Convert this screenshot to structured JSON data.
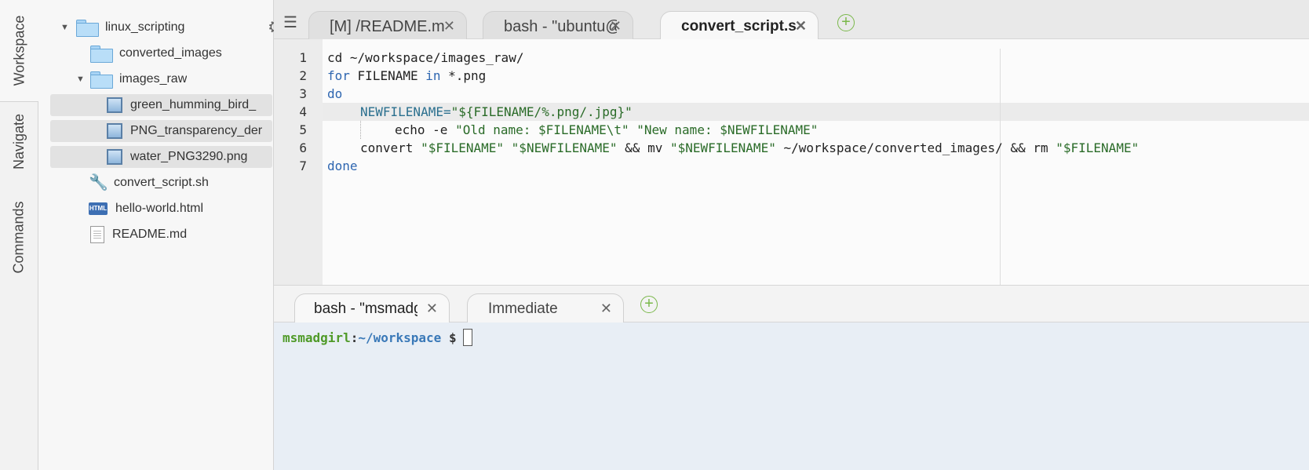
{
  "sidebar_tabs": [
    "Workspace",
    "Navigate",
    "Commands"
  ],
  "tree": {
    "root": "linux_scripting",
    "items": [
      {
        "label": "converted_images"
      },
      {
        "label": "images_raw"
      },
      {
        "label": "green_humming_bird_"
      },
      {
        "label": "PNG_transparency_der"
      },
      {
        "label": "water_PNG3290.png"
      },
      {
        "label": "convert_script.sh"
      },
      {
        "label": "hello-world.html"
      },
      {
        "label": "README.md"
      }
    ]
  },
  "editor_tabs": [
    {
      "label": "[M] /README.mc"
    },
    {
      "label": "bash - \"ubuntu@"
    },
    {
      "label": "convert_script.sl"
    }
  ],
  "code": {
    "line_numbers": [
      "1",
      "2",
      "3",
      "4",
      "5",
      "6",
      "7"
    ],
    "l1": "cd ~/workspace/images_raw/",
    "l2_kw": "for",
    "l2_a": " FILENAME ",
    "l2_kw2": "in",
    "l2_b": " *.png",
    "l3": "do",
    "l4_var": "NEWFILENAME=",
    "l4_str": "\"${FILENAME/%.png/.jpg}\"",
    "l5_a": "echo -e ",
    "l5_str": "\"Old name: $FILENAME\\t\" \"New name: $NEWFILENAME\"",
    "l6_a": "convert ",
    "l6_s1": "\"$FILENAME\"",
    "l6_s2": "\"$NEWFILENAME\"",
    "l6_b": " && mv ",
    "l6_s3": "\"$NEWFILENAME\"",
    "l6_c": " ~/workspace/converted_images/ && rm ",
    "l6_s4": "\"$FILENAME\"",
    "l7": "done"
  },
  "terminal_tabs": [
    {
      "label": "bash - \"msmadgi"
    },
    {
      "label": "Immediate"
    }
  ],
  "terminal": {
    "user": "msmadgirl",
    "path": "~/workspace",
    "symbol": "$"
  }
}
